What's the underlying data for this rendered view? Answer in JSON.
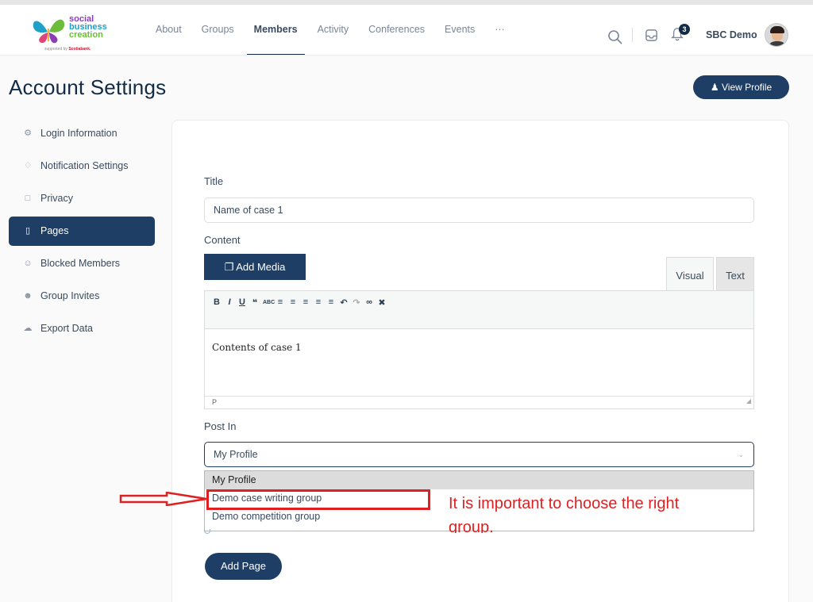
{
  "brand": {
    "line1": "social",
    "line2": "business",
    "line3": "creation",
    "sub_prefix": "supported by",
    "sub_brand": "Scotiabank."
  },
  "nav": {
    "items": [
      {
        "label": "About",
        "active": false
      },
      {
        "label": "Groups",
        "active": false
      },
      {
        "label": "Members",
        "active": true
      },
      {
        "label": "Activity",
        "active": false
      },
      {
        "label": "Conferences",
        "active": false
      },
      {
        "label": "Events",
        "active": false
      },
      {
        "label": "···",
        "active": false
      }
    ]
  },
  "topbar": {
    "icons": [
      "search-icon",
      "inbox-icon",
      "bell-icon"
    ],
    "notification_count": "3",
    "user_name": "SBC Demo"
  },
  "header": {
    "title": "Account Settings",
    "view_profile_label": "View Profile"
  },
  "sidebar": {
    "items": [
      {
        "label": "Login Information",
        "icon": "gear-icon",
        "active": false
      },
      {
        "label": "Notification Settings",
        "icon": "bell-icon",
        "active": false
      },
      {
        "label": "Privacy",
        "icon": "lock-icon",
        "active": false
      },
      {
        "label": "Pages",
        "icon": "page-icon",
        "active": true
      },
      {
        "label": "Blocked Members",
        "icon": "block-user-icon",
        "active": false
      },
      {
        "label": "Group Invites",
        "icon": "group-icon",
        "active": false
      },
      {
        "label": "Export Data",
        "icon": "cloud-download-icon",
        "active": false
      }
    ]
  },
  "form": {
    "title_label": "Title",
    "title_value": "Name of case 1",
    "content_label": "Content",
    "add_media_label": "Add Media",
    "tab_visual": "Visual",
    "tab_text": "Text",
    "editor_content": "Contents of case 1",
    "editor_path": "P",
    "post_in_label": "Post In",
    "post_in_selected": "My Profile",
    "post_in_options": [
      "My Profile",
      "Demo case writing group",
      "Demo competition group"
    ],
    "submit_label": "Add Page"
  },
  "annotation": {
    "note": "It is important to choose the right group.",
    "color": "#e02020"
  },
  "colors": {
    "primary": "#1e3e66",
    "text": "#122b46"
  }
}
